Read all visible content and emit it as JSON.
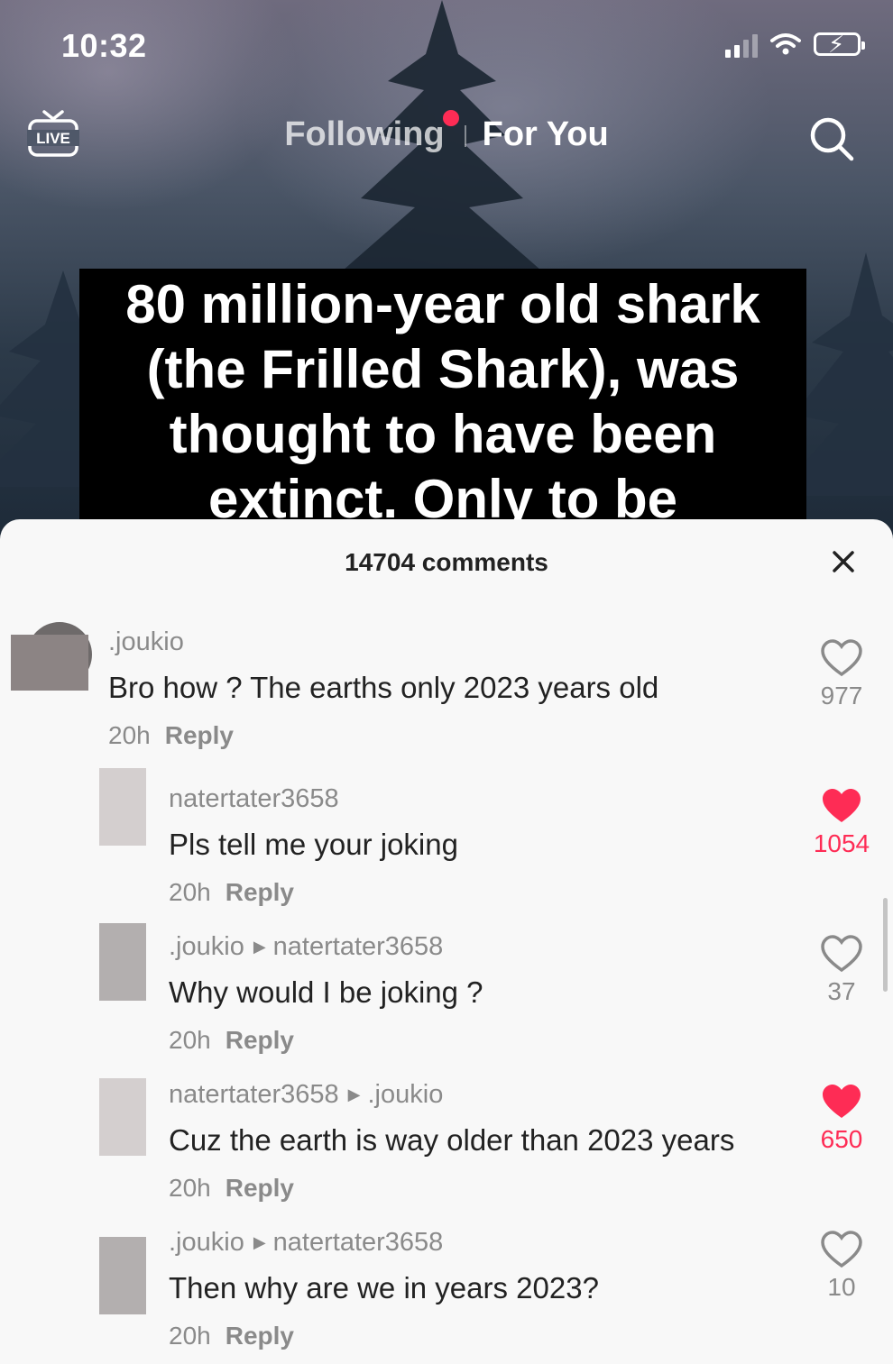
{
  "status_bar": {
    "time": "10:32",
    "battery_icon": "battery-charging-icon",
    "signal_icon": "signal-icon",
    "wifi_icon": "wifi-icon"
  },
  "top_nav": {
    "live_label": "LIVE",
    "tabs": [
      {
        "label": "Following"
      },
      {
        "label": "For You"
      }
    ],
    "notification_dot_color": "#fe2c55",
    "search_icon": "search-icon"
  },
  "video": {
    "caption_lines": [
      "80 million-year old shark",
      "(the Frilled Shark), was",
      "thought to have been",
      "extinct. Only to be"
    ]
  },
  "comments_panel": {
    "title": "14704 comments",
    "close_icon": "close-icon",
    "comments": [
      {
        "username": ".joukio",
        "reply_to": "",
        "text": "Bro how ? The earths only 2023 years old",
        "time": "20h",
        "reply_label": "Reply",
        "likes": "977",
        "liked": false
      },
      {
        "username": "natertater3658",
        "reply_to": "",
        "text": "Pls tell me your joking",
        "time": "20h",
        "reply_label": "Reply",
        "likes": "1054",
        "liked": true
      },
      {
        "username": ".joukio",
        "reply_to": "natertater3658",
        "text": "Why would I be joking ?",
        "time": "20h",
        "reply_label": "Reply",
        "likes": "37",
        "liked": false
      },
      {
        "username": "natertater3658",
        "reply_to": ".joukio",
        "text": "Cuz the earth is way older than 2023 years",
        "time": "20h",
        "reply_label": "Reply",
        "likes": "650",
        "liked": true
      },
      {
        "username": ".joukio",
        "reply_to": "natertater3658",
        "text": "Then why are we in years 2023?",
        "time": "20h",
        "reply_label": "Reply",
        "likes": "10",
        "liked": false
      }
    ]
  },
  "colors": {
    "accent": "#fe2c55",
    "sheet_bg": "#f8f8f8",
    "secondary_text": "#8a8a8a"
  }
}
